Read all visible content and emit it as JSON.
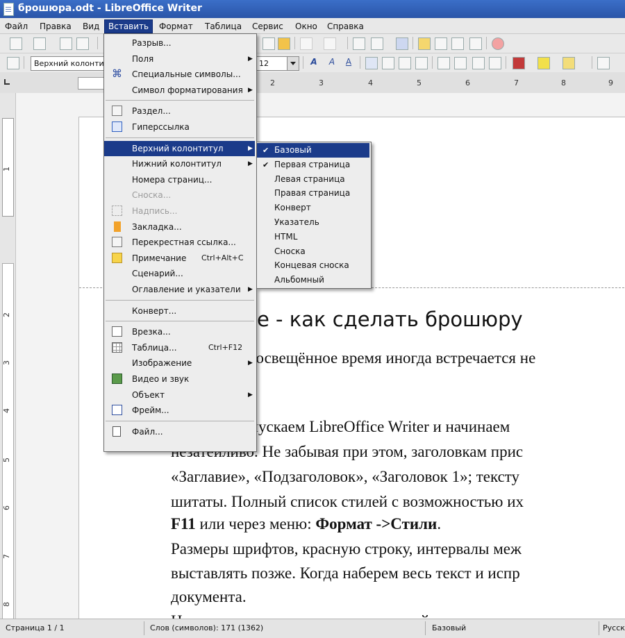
{
  "window": {
    "title": "брошюра.odt - LibreOffice Writer"
  },
  "menubar": {
    "items": [
      {
        "label": "Файл",
        "active": false
      },
      {
        "label": "Правка",
        "active": false
      },
      {
        "label": "Вид",
        "active": false
      },
      {
        "label": "Вставить",
        "active": true
      },
      {
        "label": "Формат",
        "active": false
      },
      {
        "label": "Таблица",
        "active": false
      },
      {
        "label": "Сервис",
        "active": false
      },
      {
        "label": "Окно",
        "active": false
      },
      {
        "label": "Справка",
        "active": false
      }
    ]
  },
  "formatting": {
    "style_value": "Верхний колонтит",
    "size_value": "12"
  },
  "ruler": {
    "marks": [
      "2",
      "3",
      "4",
      "5",
      "6",
      "7",
      "8",
      "9"
    ]
  },
  "vruler": {
    "marks": [
      "1",
      "2",
      "3",
      "4",
      "5",
      "6",
      "7",
      "8"
    ]
  },
  "insert_menu": {
    "items": [
      {
        "label": "Разрыв...",
        "icon": "",
        "shortcut": "",
        "submenu": false,
        "disabled": false
      },
      {
        "label": "Поля",
        "icon": "",
        "shortcut": "",
        "submenu": true,
        "disabled": false
      },
      {
        "label": "Специальные символы...",
        "icon": "special-chars-icon",
        "shortcut": "",
        "submenu": false,
        "disabled": false
      },
      {
        "label": "Символ форматирования",
        "icon": "",
        "shortcut": "",
        "submenu": true,
        "disabled": false
      },
      {
        "sep": true
      },
      {
        "label": "Раздел...",
        "icon": "section-icon",
        "shortcut": "",
        "submenu": false,
        "disabled": false
      },
      {
        "label": "Гиперссылка",
        "icon": "hyperlink-icon",
        "shortcut": "",
        "submenu": false,
        "disabled": false
      },
      {
        "sep": true
      },
      {
        "label": "Верхний колонтитул",
        "icon": "",
        "shortcut": "",
        "submenu": true,
        "disabled": false,
        "highlighted": true
      },
      {
        "label": "Нижний колонтитул",
        "icon": "",
        "shortcut": "",
        "submenu": true,
        "disabled": false
      },
      {
        "label": "Номера страниц...",
        "icon": "",
        "shortcut": "",
        "submenu": false,
        "disabled": false
      },
      {
        "label": "Сноска...",
        "icon": "",
        "shortcut": "",
        "submenu": false,
        "disabled": true
      },
      {
        "label": "Надпись...",
        "icon": "caption-icon",
        "shortcut": "",
        "submenu": false,
        "disabled": true
      },
      {
        "label": "Закладка...",
        "icon": "bookmark-icon",
        "shortcut": "",
        "submenu": false,
        "disabled": false
      },
      {
        "label": "Перекрестная ссылка...",
        "icon": "cross-reference-icon",
        "shortcut": "",
        "submenu": false,
        "disabled": false
      },
      {
        "label": "Примечание",
        "icon": "comment-icon",
        "shortcut": "Ctrl+Alt+C",
        "submenu": false,
        "disabled": false
      },
      {
        "label": "Сценарий...",
        "icon": "",
        "shortcut": "",
        "submenu": false,
        "disabled": false
      },
      {
        "label": "Оглавление и указатели",
        "icon": "",
        "shortcut": "",
        "submenu": true,
        "disabled": false
      },
      {
        "sep": true
      },
      {
        "label": "Конверт...",
        "icon": "",
        "shortcut": "",
        "submenu": false,
        "disabled": false
      },
      {
        "sep": true
      },
      {
        "label": "Врезка...",
        "icon": "frame-icon",
        "shortcut": "",
        "submenu": false,
        "disabled": false
      },
      {
        "label": "Таблица...",
        "icon": "table-icon",
        "shortcut": "Ctrl+F12",
        "submenu": false,
        "disabled": false
      },
      {
        "label": "Изображение",
        "icon": "",
        "shortcut": "",
        "submenu": true,
        "disabled": false
      },
      {
        "label": "Видео и звук",
        "icon": "media-icon",
        "shortcut": "",
        "submenu": false,
        "disabled": false
      },
      {
        "label": "Объект",
        "icon": "",
        "shortcut": "",
        "submenu": true,
        "disabled": false
      },
      {
        "label": "Фрейм...",
        "icon": "floating-frame-icon",
        "shortcut": "",
        "submenu": false,
        "disabled": false
      },
      {
        "sep": true
      },
      {
        "label": "Файл...",
        "icon": "file-icon",
        "shortcut": "",
        "submenu": false,
        "disabled": false
      }
    ]
  },
  "header_submenu": {
    "items": [
      {
        "label": "Базовый",
        "checked": true,
        "highlighted": true
      },
      {
        "label": "Первая страница",
        "checked": true,
        "highlighted": false
      },
      {
        "label": "Левая страница",
        "checked": false,
        "highlighted": false
      },
      {
        "label": "Правая страница",
        "checked": false,
        "highlighted": false
      },
      {
        "label": "Конверт",
        "checked": false,
        "highlighted": false
      },
      {
        "label": "Указатель",
        "checked": false,
        "highlighted": false
      },
      {
        "label": "HTML",
        "checked": false,
        "highlighted": false
      },
      {
        "label": "Сноска",
        "checked": false,
        "highlighted": false
      },
      {
        "label": "Концевая сноска",
        "checked": false,
        "highlighted": false
      },
      {
        "label": "Альбомный",
        "checked": false,
        "highlighted": false
      }
    ]
  },
  "document": {
    "heading": "ice  - как сделать брошюру",
    "lines": [
      {
        "text": "росвещённое время иногда встречается не"
      },
      {
        "text": "х: запускаем LibreOffice Writer и начинаем"
      },
      {
        "text": "незатейливо. Не забывая при этом, заголовкам прис"
      },
      {
        "text": "«Заглавие», «Подзаголовок», «Заголовок 1»; тексту"
      },
      {
        "text": "шитаты. Полный список стилей с возможностью их"
      },
      {
        "bold1": "F11",
        "mid": " или через меню:  ",
        "bold2": "Формат ->Стили",
        "tail": "."
      },
      {
        "text": "Размеры шрифтов, красную строку, интервалы меж"
      },
      {
        "text": "выставлять позже. Когда наберем весь текст и испр"
      },
      {
        "text": "документа."
      },
      {
        "text": "На основании «заголовочных» стилей через меню:"
      }
    ]
  },
  "statusbar": {
    "page": "Страница 1 / 1",
    "words": "Слов (символов): 171 (1362)",
    "style": "Базовый",
    "language": "Русск"
  }
}
